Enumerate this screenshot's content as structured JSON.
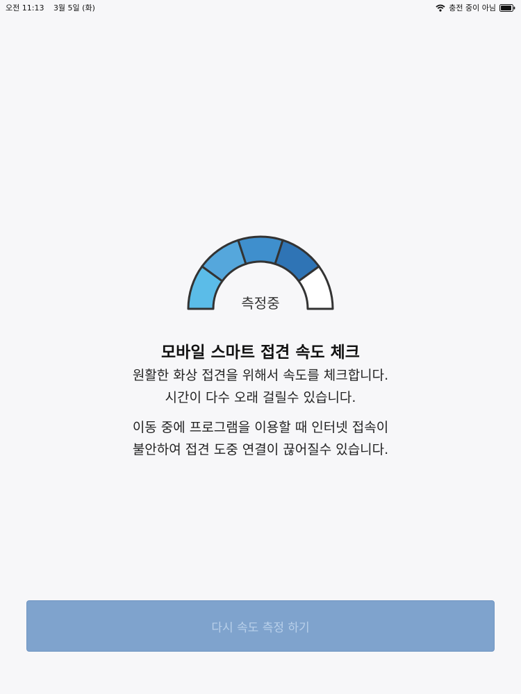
{
  "status_bar": {
    "time": "오전 11:13",
    "date": "3월 5일 (화)",
    "charging": "충전 중이 아님",
    "wifi_icon": "wifi-icon",
    "battery_icon": "battery-icon"
  },
  "gauge": {
    "label": "측정중",
    "segment_colors": [
      "#5bbce8",
      "#55a7dc",
      "#3f8fcd",
      "#2f74b5",
      "#ffffff"
    ],
    "outline_color": "#333333"
  },
  "main": {
    "title": "모바일 스마트 접견 속도 체크",
    "desc1_line1": "원활한 화상 접견을 위해서 속도를 체크합니다.",
    "desc1_line2": "시간이 다수 오래 걸릴수 있습니다.",
    "desc2_line1": "이동 중에 프로그램을 이용할 때 인터넷 접속이",
    "desc2_line2": "불안하여 접견 도중 연결이 끊어질수 있습니다."
  },
  "retry_button": {
    "label": "다시 속도 측정 하기"
  }
}
